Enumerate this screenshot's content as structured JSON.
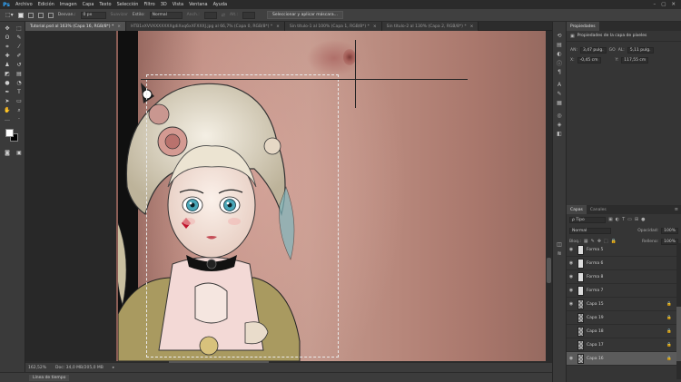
{
  "app": {
    "logo": "Ps"
  },
  "menu": [
    "Archivo",
    "Edición",
    "Imagen",
    "Capa",
    "Texto",
    "Selección",
    "Filtro",
    "3D",
    "Vista",
    "Ventana",
    "Ayuda"
  ],
  "window_controls": {
    "minimize": "–",
    "maximize": "▢",
    "close": "✕"
  },
  "options": {
    "feather_label": "Desvan.:",
    "feather_value": "0 px",
    "smooth_label": "Suavizar",
    "style_label": "Estilo:",
    "style_value": "Normal",
    "width_label": "Anch.:",
    "height_label": "Alt.:",
    "mask_button": "Seleccionar y aplicar máscara..."
  },
  "doc_tabs": [
    {
      "title": "Tutorial.psd al 163% (Capa 16, RGB/8*) *",
      "active": true
    },
    {
      "title": "HTB1xXVVXXXXXXXgdiXxq6xXFXXXJ.jpg al 66,7% (Capa 0, RGB/8*) *",
      "active": false
    },
    {
      "title": "Sin título-1 al 100% (Capa 1, RGB/8*) *",
      "active": false
    },
    {
      "title": "Sin título-2 al 130% (Capa 2, RGB/8*) *",
      "active": false
    }
  ],
  "tab_close": "×",
  "status": {
    "zoom": "162,52%",
    "doc": "Doc: 34,0 MB/205,0 MB"
  },
  "timeline": {
    "label": "Línea de tiempo"
  },
  "properties": {
    "tab": "Propiedades",
    "header": "Propiedades de la capa de píxeles",
    "w_label": "AN:",
    "w_value": "3,47 pulg.",
    "link_label": "GO",
    "h_label": "AL:",
    "h_value": "5,11 pulg.",
    "x_label": "X:",
    "x_value": "-0,45 cm",
    "y_label": "Y:",
    "y_value": "117,55 cm"
  },
  "layers": {
    "tabs": [
      "Capas",
      "Canales"
    ],
    "filter_label": "ρ Tipo",
    "blend_mode": "Normal",
    "opacity_label": "Opacidad:",
    "opacity_value": "100%",
    "lock_label": "Bloq.:",
    "fill_label": "Relleno:",
    "fill_value": "100%",
    "items": [
      {
        "name": "Forma 5",
        "kind": "shape",
        "visible": true,
        "locked": false,
        "selected": false
      },
      {
        "name": "Forma 6",
        "kind": "shape",
        "visible": true,
        "locked": false,
        "selected": false
      },
      {
        "name": "Forma 8",
        "kind": "shape",
        "visible": true,
        "locked": false,
        "selected": false
      },
      {
        "name": "Forma 7",
        "kind": "shape",
        "visible": true,
        "locked": false,
        "selected": false
      },
      {
        "name": "Capa 15",
        "kind": "pixel",
        "visible": true,
        "locked": true,
        "selected": false
      },
      {
        "name": "Capa 19",
        "kind": "pixel",
        "visible": false,
        "locked": true,
        "selected": false
      },
      {
        "name": "Capa 18",
        "kind": "pixel",
        "visible": false,
        "locked": true,
        "selected": false
      },
      {
        "name": "Capa 17",
        "kind": "pixel",
        "visible": false,
        "locked": true,
        "selected": false
      },
      {
        "name": "Capa 16",
        "kind": "pixel",
        "visible": true,
        "locked": true,
        "selected": true
      }
    ]
  }
}
